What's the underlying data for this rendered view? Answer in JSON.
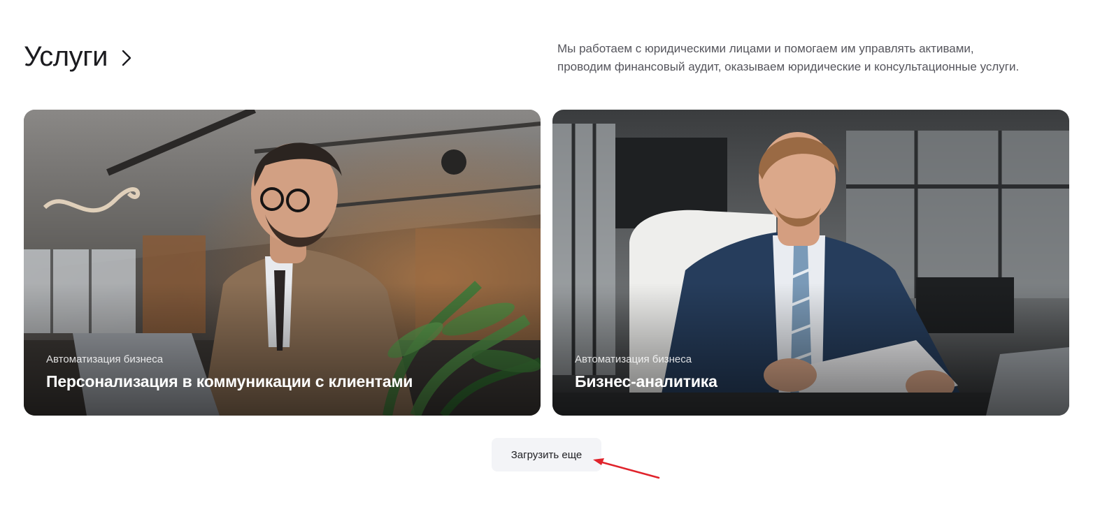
{
  "header": {
    "title": "Услуги",
    "intro_line1": "Мы работаем с юридическими лицами и помогаем им управлять активами,",
    "intro_line2": "проводим финансовый аудит, оказываем юридические и консультационные услуги."
  },
  "cards": [
    {
      "category": "Автоматизация бизнеса",
      "title": "Персонализация в коммуникации с клиентами"
    },
    {
      "category": "Автоматизация бизнеса",
      "title": "Бизнес-аналитика"
    }
  ],
  "load_more": {
    "label": "Загрузить еще"
  },
  "colors": {
    "accent_arrow": "#e0232b",
    "button_bg": "#f3f4f7",
    "text_primary": "#1b1b1f",
    "text_secondary": "#55555c"
  }
}
